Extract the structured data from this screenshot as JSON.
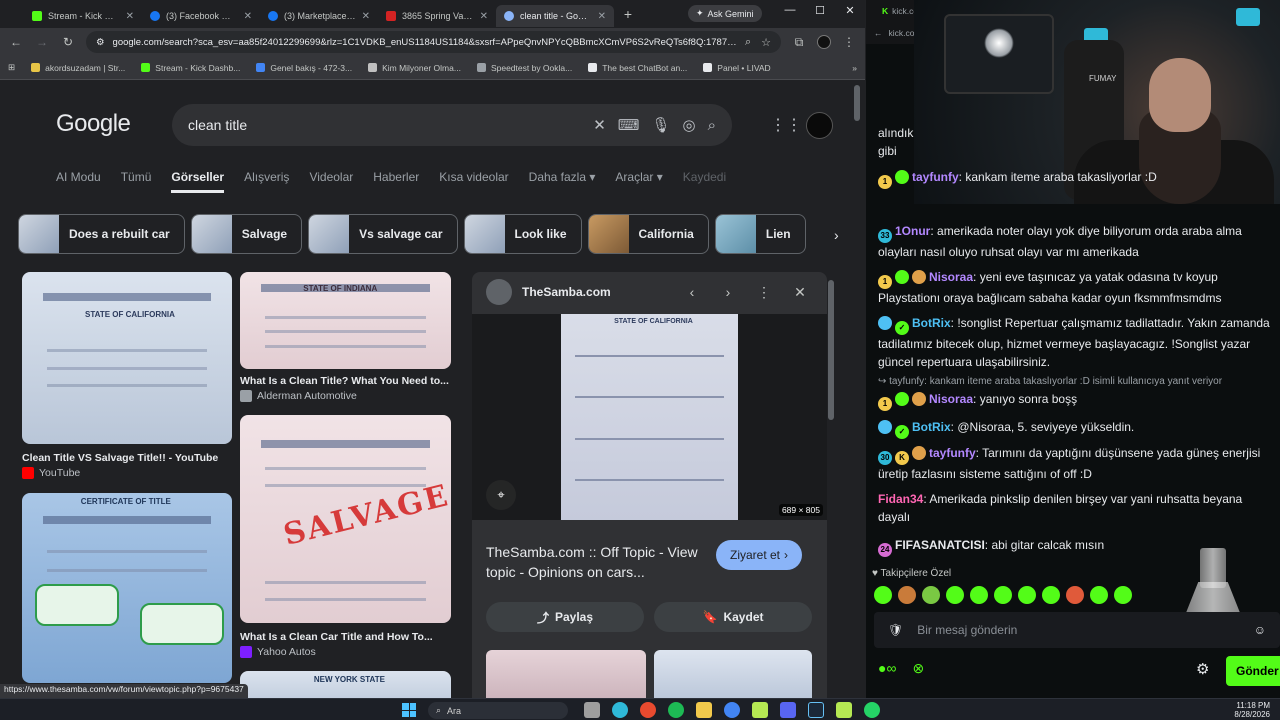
{
  "browser": {
    "tabs": [
      {
        "label": "Stream - Kick Dashb",
        "color": "#53fc18",
        "active": false
      },
      {
        "label": "(3) Facebook Marke",
        "color": "#1877f2",
        "active": false
      },
      {
        "label": "(3) Marketplace - St",
        "color": "#1877f2",
        "active": false
      },
      {
        "label": "3865 Spring Valley",
        "color": "#d32323",
        "active": false
      },
      {
        "label": "clean title - Google",
        "color": "#8ab4f8",
        "active": true
      }
    ],
    "new_tab": "+",
    "ask_gemini": "Ask Gemini",
    "url": "google.com/search?sca_esv=aa85f24012299699&rlz=1C1VDKB_enUS1184US1184&sxsrf=APpeQnvNPYcQBBmcXCmVP6S2vReQTs6f8Q:17879842...",
    "bookmarks": [
      {
        "label": "akordsuzadam | Str...",
        "color": "#e8c547"
      },
      {
        "label": "Stream - Kick Dashb...",
        "color": "#53fc18"
      },
      {
        "label": "Genel bakış - 472-3...",
        "color": "#4285f4"
      },
      {
        "label": "Kim Milyoner Olma...",
        "color": "#c0c0c0"
      },
      {
        "label": "Speedtest by Ookla...",
        "color": "#9aa0a6"
      },
      {
        "label": "The best ChatBot an...",
        "color": "#e8eaed"
      },
      {
        "label": "Panel • LIVAD",
        "color": "#e8eaed"
      }
    ],
    "status_url": "https://www.thesamba.com/vw/forum/viewtopic.php?p=9675437"
  },
  "google": {
    "logo": "Google",
    "query": "clean title",
    "nav_tabs": [
      "AI Modu",
      "Tümü",
      "Görseller",
      "Alışveriş",
      "Videolar",
      "Haberler",
      "Kısa videolar",
      "Daha fazla ▾",
      "Araçlar ▾",
      "Kaydedi"
    ],
    "active_tab": "Görseller",
    "chips": [
      "Does a rebuilt car",
      "Salvage",
      "Vs salvage car",
      "Look like",
      "California",
      "Lien"
    ],
    "results": [
      {
        "title": "Clean Title VS Salvage Title!! - YouTube",
        "source": "YouTube",
        "source_color": "#ff0000",
        "image_text": "STATE OF CALIFORNIA"
      },
      {
        "title": "What Is a Clean Title? What You Need to...",
        "source": "Alderman Automotive",
        "source_color": "#9aa0a6",
        "image_text": "STATE OF INDIANA"
      },
      {
        "title": "What Is a Clean Car Title and How To...",
        "source": "Yahoo Autos",
        "source_color": "#7e1fff",
        "image_text": "SALVAGE"
      },
      {
        "title": "",
        "source": "",
        "source_color": "#4285f4",
        "image_text": "CERTIFICATE OF TITLE"
      },
      {
        "title": "",
        "source": "",
        "source_color": "#4285f4",
        "image_text": "NEW YORK STATE"
      }
    ],
    "preview": {
      "site": "TheSamba.com",
      "dimensions": "689 × 805",
      "image_text": "STATE OF CALIFORNIA",
      "title": "TheSamba.com :: Off Topic - View topic - Opinions on cars...",
      "visit": "Ziyaret et",
      "share": "Paylaş",
      "save": "Kaydet"
    }
  },
  "kick": {
    "url_top": "kick.com",
    "url_top2": "kick.co",
    "cam_label": "FUMAY",
    "messages": [
      {
        "user": "",
        "text": "alındık gibi",
        "color": "#e8eaed"
      },
      {
        "user": "tayfunfy",
        "text": "kankam iteme araba takasliyorlar :D",
        "color": "#b388ff"
      },
      {
        "user": "1Onur",
        "text": "amerikada noter olayı yok diye biliyorum orda araba alma olayları nasıl oluyo ruhsat olayı var mı amerikada",
        "color": "#b388ff"
      },
      {
        "user": "Nisoraa",
        "text": "yeni eve taşınıcaz ya yatak odasına tv koyup Playstationı oraya bağlıcam sabaha kadar oyun fksmmfmsmdms",
        "color": "#b388ff"
      },
      {
        "user": "BotRix",
        "text": "!songlist Repertuar çalışmamız tadilattadır. Yakın zamanda tadilatımız bitecek olup, hizmet vermeye başlayacagız. !Songlist yazar güncel repertuara ulaşabilirsiniz.",
        "color": "#4ec0f4"
      },
      {
        "reply": "↪ tayfunfy: kankam iteme araba takaslıyorlar :D isimli kullanıcıya yanıt veriyor"
      },
      {
        "user": "Nisoraa",
        "text": "yanıyo sonra boşş",
        "color": "#b388ff"
      },
      {
        "user": "BotRix",
        "text": "@Nisoraa, 5. seviyeye yükseldin.",
        "color": "#4ec0f4"
      },
      {
        "user": "tayfunfy",
        "text": "Tarımını da yaptığını düşünsene yada güneş enerjisi üretip fazlasını sisteme sattığını of off :D",
        "color": "#b388ff"
      },
      {
        "user": "Fidan34",
        "text": "Amerikada pinkslip denilen birşey var yani ruhsatta beyana dayalı",
        "color": "#ff66b3"
      },
      {
        "user": "FIFASANATCISI",
        "text": "abi gitar calcak mısın",
        "color": "#e8eaed"
      }
    ],
    "follower_label": "♥ Takipçilere Özel",
    "input_placeholder": "Bir mesaj gönderin",
    "send": "Gönder",
    "emote_colors": [
      "#53fc18",
      "#c97b3a",
      "#7ac943",
      "#53fc18",
      "#53fc18",
      "#53fc18",
      "#53fc18",
      "#53fc18",
      "#e05a3a",
      "#53fc18",
      "#53fc18"
    ]
  },
  "taskbar": {
    "search": "Ara",
    "time": "11:18 PM",
    "date": "8/28/2026",
    "app_colors": [
      "#9e9e9e",
      "#2fb9d8",
      "#e84a2f",
      "#1db954",
      "#f2c94c",
      "#4285f4",
      "#b5e853",
      "#5865f2",
      "#1b2838",
      "#b5e853",
      "#25d366"
    ]
  }
}
